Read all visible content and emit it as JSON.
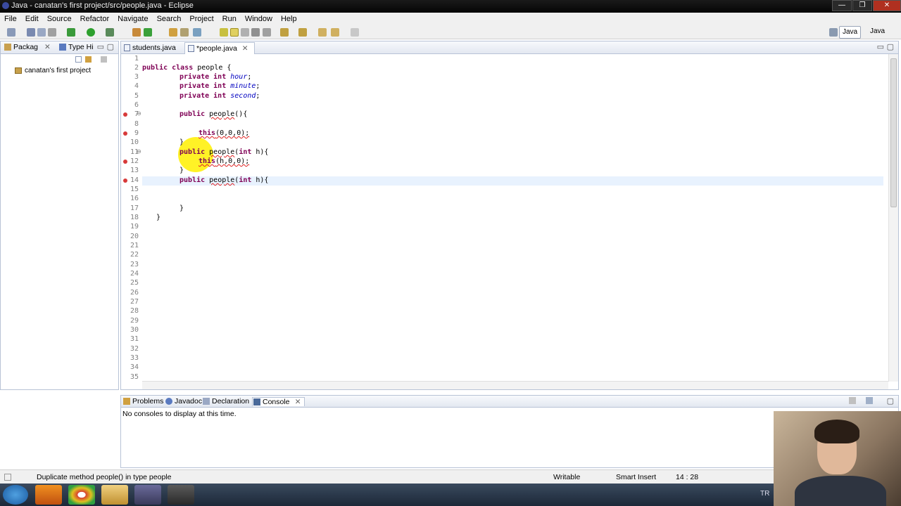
{
  "window": {
    "title": "Java - canatan's first project/src/people.java - Eclipse",
    "controls": [
      "—",
      "❐",
      "✕"
    ]
  },
  "menu": [
    "File",
    "Edit",
    "Source",
    "Refactor",
    "Navigate",
    "Search",
    "Project",
    "Run",
    "Window",
    "Help"
  ],
  "perspectives": [
    "Java",
    "Java"
  ],
  "left_panel": {
    "tabs": [
      "Packag",
      "Type Hi"
    ],
    "tree_item": "canatan's first project"
  },
  "editor": {
    "tabs": [
      {
        "label": "students.java",
        "active": false
      },
      {
        "label": "*people.java",
        "active": true
      }
    ],
    "line_numbers": [
      "1",
      "2",
      "3",
      "4",
      "5",
      "6",
      "7",
      "8",
      "9",
      "10",
      "11",
      "12",
      "13",
      "14",
      "15",
      "16",
      "17",
      "18",
      "19",
      "20",
      "21",
      "22",
      "23",
      "24",
      "25",
      "26",
      "27",
      "28",
      "29",
      "30",
      "31",
      "32",
      "33",
      "34",
      "35"
    ],
    "code": {
      "l2a": "public class",
      "l2b": " people {",
      "l3a": "private int",
      "l3b": "hour",
      "l3c": ";",
      "l4a": "private int",
      "l4b": "minute",
      "l4c": ";",
      "l5a": "private int",
      "l5b": "second",
      "l5c": ";",
      "l7a": "public",
      "l7b": "people",
      "l7c": "(){",
      "l9a": "this",
      "l9b": "(0,0,0);",
      "l10": "}",
      "l11a": "public",
      "l11b": "people",
      "l11c": "(",
      "l11d": "int",
      "l11e": " h){",
      "l12a": "this",
      "l12b": "(h,0,0);",
      "l13": "}",
      "l14a": "public",
      "l14b": "people",
      "l14c": "(",
      "l14d": "int",
      "l14e": " h){",
      "l17": "}",
      "l18": "}"
    }
  },
  "bottom_panel": {
    "tabs": [
      "Problems",
      "Javadoc",
      "Declaration",
      "Console"
    ],
    "message": "No consoles to display at this time."
  },
  "status": {
    "message": "Duplicate method people() in type people",
    "mode": "Writable",
    "insert": "Smart Insert",
    "position": "14 : 28"
  },
  "taskbar": {
    "lang": "TR"
  },
  "colors": {
    "keyword": "#7f0055",
    "field": "#0000c0",
    "error": "#e02020",
    "current_line": "#e8f2fe",
    "highlight": "#fff000"
  }
}
